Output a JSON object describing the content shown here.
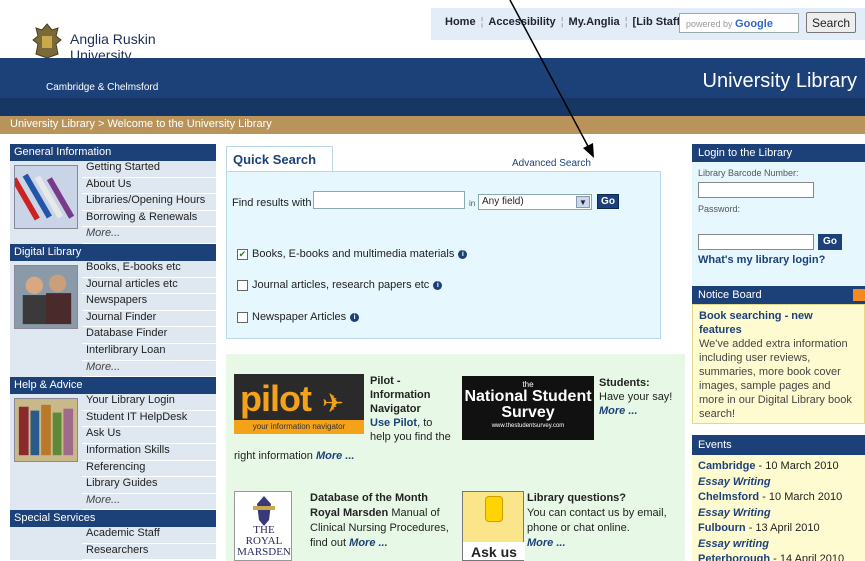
{
  "header": {
    "logo_line1": "Anglia Ruskin",
    "logo_line2": "University",
    "util_links": [
      "Home",
      "Accessibility",
      "My.Anglia",
      "[Lib Staff]"
    ],
    "search_placeholder": "powered by",
    "search_brand": "Google",
    "search_button": "Search"
  },
  "banner": {
    "campus": "Cambridge & Chelmsford",
    "title": "University Library"
  },
  "breadcrumb": "University Library > Welcome to the University Library",
  "leftnav": {
    "general": {
      "heading": "General Information",
      "items": [
        "Getting Started",
        "About Us",
        "Libraries/Opening Hours",
        "Borrowing & Renewals",
        "More..."
      ]
    },
    "digital": {
      "heading": "Digital Library",
      "items": [
        "Books, E-books etc",
        "Journal articles etc",
        "Newspapers",
        "Journal Finder",
        "Database Finder",
        "Interlibrary Loan",
        "More..."
      ]
    },
    "help": {
      "heading": "Help & Advice",
      "items": [
        "Your Library Login",
        "Student IT HelpDesk",
        "Ask Us",
        "Information Skills",
        "Referencing",
        "Library Guides",
        "More..."
      ]
    },
    "special": {
      "heading": "Special Services",
      "items": [
        "Academic Staff",
        "Researchers"
      ]
    }
  },
  "quicksearch": {
    "tab": "Quick Search",
    "advanced": "Advanced Search",
    "find_label": "Find results with",
    "in_label": "in",
    "field_select": "Any field)",
    "go": "Go",
    "options": [
      {
        "label": "Books, E-books and multimedia materials",
        "checked": true
      },
      {
        "label": "Journal articles, research papers etc",
        "checked": false
      },
      {
        "label": "Newspaper Articles",
        "checked": false
      }
    ]
  },
  "features": {
    "pilot": {
      "logo": "pilot",
      "tagline": "your information navigator",
      "text1": "Pilot - Information Navigator",
      "link1": "Use Pilot",
      "text2": ", to help you find the",
      "text3": "right information",
      "more": "More ..."
    },
    "nss": {
      "logo_top": "the",
      "logo_main": "National Student Survey",
      "logo_url": "www.thestudentsurvey.com",
      "heading": "Students:",
      "text": "Have your say!",
      "more": "More ..."
    },
    "database": {
      "logo": "THE ROYAL MARSDEN",
      "heading": "Database of the Month",
      "name": "Royal Marsden",
      "text": "Manual of Clinical Nursing Procedures, find out",
      "more": "More ..."
    },
    "ask": {
      "logo": "Ask us",
      "heading": "Library questions?",
      "text": "You can contact us by email, phone or chat online.",
      "more": "More ..."
    }
  },
  "login": {
    "heading": "Login to the Library",
    "barcode_label": "Library Barcode Number:",
    "password_label": "Password:",
    "go": "Go",
    "help": "What's my library login?"
  },
  "notice": {
    "heading": "Notice Board",
    "title": "Book searching - new features",
    "body": "We've added extra information including user reviews, summaries, more book cover images, sample pages and more in our Digital Library book search!"
  },
  "events": {
    "heading": "Events",
    "items": [
      {
        "place": "Cambridge",
        "date": " - 10 March 2010",
        "title": "Essay Writing"
      },
      {
        "place": "Chelmsford",
        "date": " - 10 March 2010",
        "title": "Essay Writing"
      },
      {
        "place": "Fulbourn",
        "date": " - 13 April 2010",
        "title": "Essay writing"
      },
      {
        "place": "Peterborough",
        "date": " - 14 April 2010",
        "title": ""
      }
    ]
  }
}
